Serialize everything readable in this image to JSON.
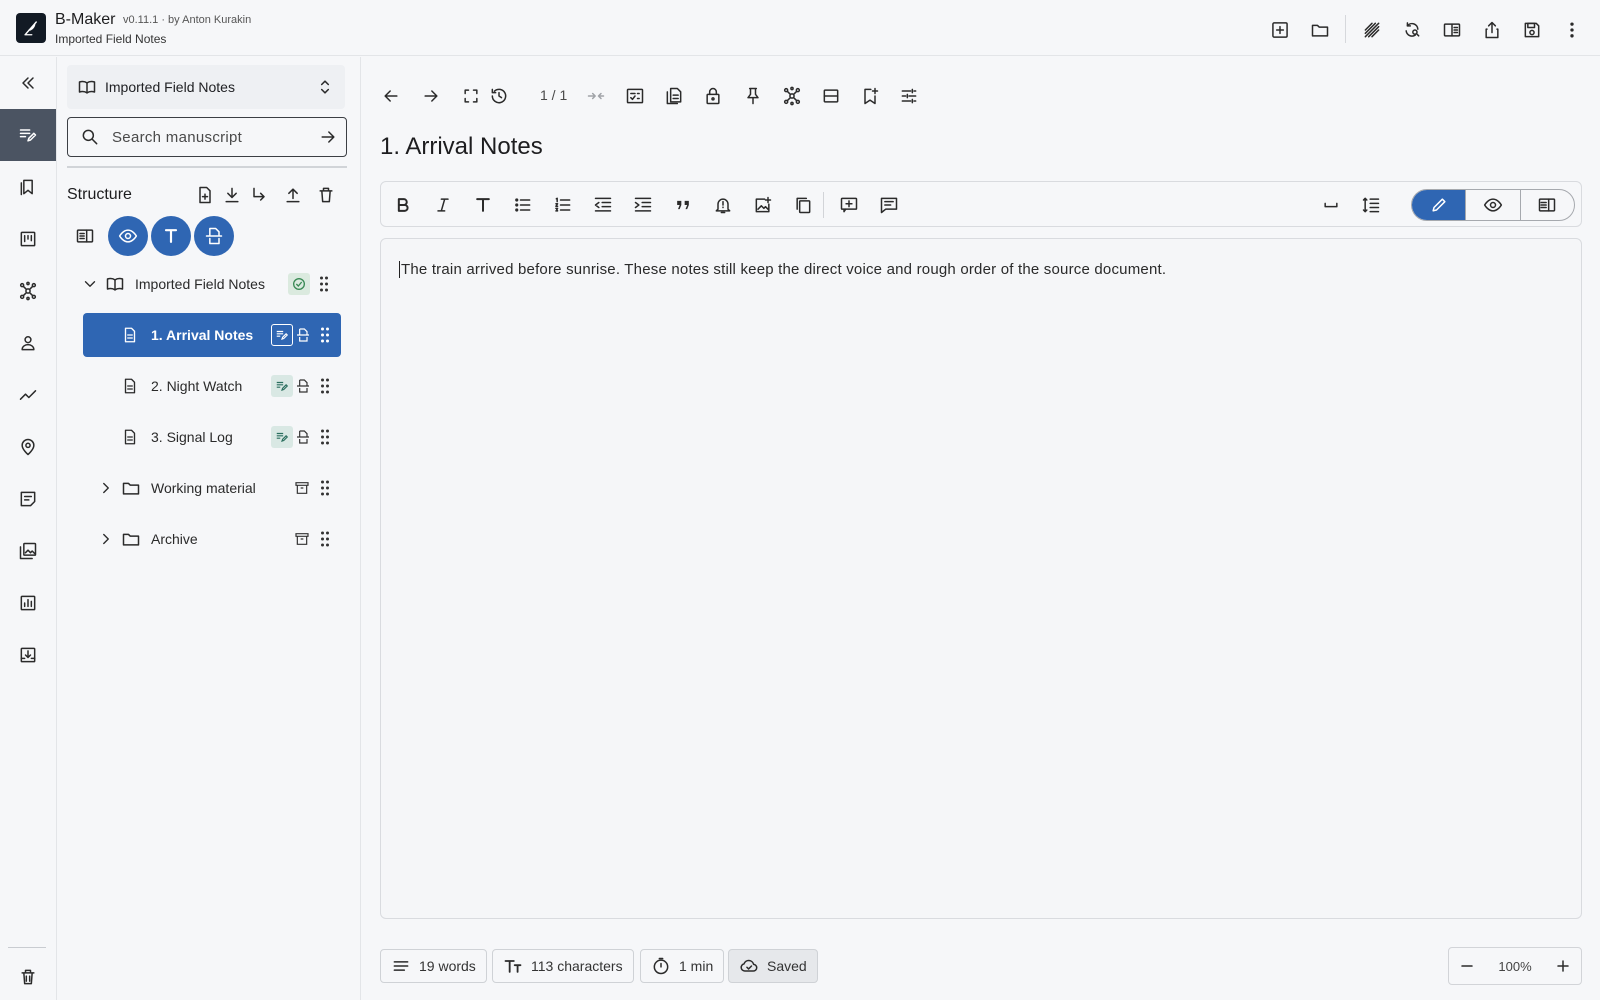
{
  "app": {
    "title": "B-Maker",
    "version": "v0.11.1 · by Anton Kurakin",
    "subtitle": "Imported Field Notes"
  },
  "topbar": {
    "actions": [
      "add-box-icon",
      "folder-icon",
      "stripes-icon",
      "sync-search-icon",
      "split-view-icon",
      "share-icon",
      "save-icon",
      "more-vert-icon"
    ]
  },
  "rail": {
    "items": [
      "collapse-icon",
      "edit-icon",
      "bookmark-icon",
      "board-icon",
      "graph-icon",
      "person-icon",
      "trend-icon",
      "location-icon",
      "notes-icon",
      "images-icon",
      "stats-icon",
      "import-icon"
    ],
    "active": "edit-icon",
    "bottom": "trash-icon"
  },
  "sidebar": {
    "project_name": "Imported Field Notes",
    "search_placeholder": "Search manuscript",
    "structure_title": "Structure",
    "tree": {
      "root": "Imported Field Notes",
      "chapters": [
        "1. Arrival Notes",
        "2. Night Watch",
        "3. Signal Log"
      ],
      "folders": [
        "Working material",
        "Archive"
      ],
      "selected": "1. Arrival Notes"
    }
  },
  "toolbar": {
    "page_count": "1 / 1"
  },
  "document": {
    "title": "1. Arrival Notes",
    "body": "The train arrived before sunrise. These notes still keep the direct voice and rough order of the source document.",
    "mode": "edit"
  },
  "status": {
    "words": "19 words",
    "characters": "113 characters",
    "reading_time": "1 min",
    "save_state": "Saved",
    "zoom": "100%"
  },
  "colors": {
    "accent": "#2f66b3",
    "rail_active": "#4b5462"
  }
}
